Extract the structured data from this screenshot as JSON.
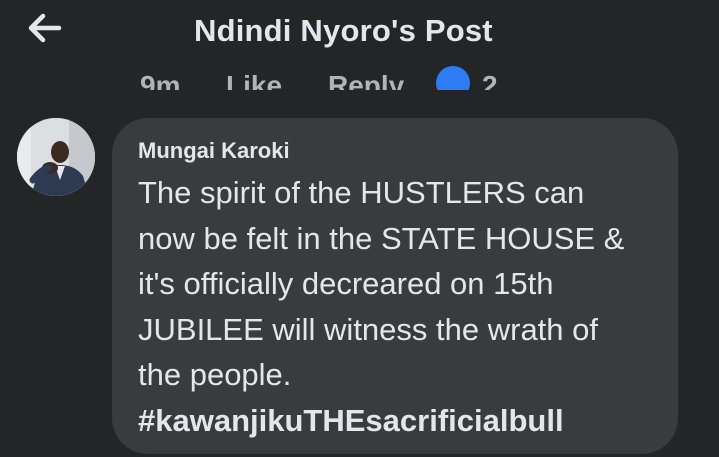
{
  "header": {
    "title": "Ndindi Nyoro's Post",
    "back_icon": "arrow-left-icon"
  },
  "previous_comment_actions": {
    "time": "9m",
    "like_label": "Like",
    "reply_label": "Reply",
    "reaction_icon": "like-reaction-icon",
    "reaction_count": "2"
  },
  "comment": {
    "author": "Mungai Karoki",
    "avatar_icon": "profile-photo",
    "lines": [
      "The spirit of the HUSTLERS can",
      "now be felt in the STATE HOUSE &",
      "it's officially decreared on 15th",
      "JUBILEE will witness the wrath of",
      "the people."
    ],
    "hashtag": "#kawanjikuTHEsacrificialbull"
  },
  "colors": {
    "background": "#242526",
    "bubble": "#3a3b3c",
    "text": "#e4e6eb",
    "secondary_text": "#b0b3b8",
    "reaction_blue": "#2d7cf6"
  }
}
